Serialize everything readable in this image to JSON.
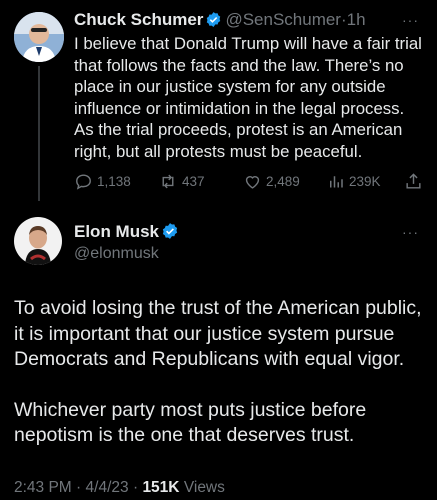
{
  "quoted_tweet": {
    "author_name": "Chuck Schumer",
    "handle": "@SenSchumer",
    "separator": "·",
    "time": "1h",
    "text": "I believe that Donald Trump will have a fair trial that follows the facts and the law. There’s no place in our justice system for any outside influence or intimidation in the legal process. As the trial proceeds, protest is an American right, but all protests must be peaceful.",
    "replies": "1,138",
    "reposts": "437",
    "likes": "2,489",
    "views": "239K",
    "more": "···"
  },
  "main_tweet": {
    "author_name": "Elon Musk",
    "handle": "@elonmusk",
    "more": "···",
    "paragraphs": [
      "To avoid losing the trust of the American public, it is important that our justice system pursue Democrats and Republicans with equal vigor.",
      "Whichever party most puts justice before nepotism is the one that deserves trust."
    ],
    "time": "2:43 PM",
    "date": "4/4/23",
    "separator": "·",
    "views_count": "151K",
    "views_label": "Views"
  },
  "colors": {
    "background": "#000000",
    "text": "#e7e9ea",
    "muted": "#71767b",
    "verified": "#1d9bf0",
    "thread_line": "#333639"
  },
  "icons": [
    "verified-badge-icon",
    "reply-icon",
    "repost-icon",
    "like-icon",
    "views-icon",
    "share-icon",
    "more-icon"
  ]
}
